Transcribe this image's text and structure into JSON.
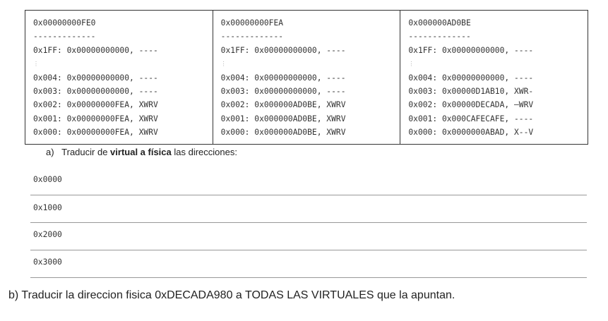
{
  "tables": [
    {
      "header": "0x00000000FE0",
      "sep": "-------------",
      "rows": [
        "0x1FF: 0x00000000000, ----",
        "⋮",
        "0x004: 0x00000000000, ----",
        "0x003: 0x00000000000, ----",
        "0x002: 0x00000000FEA, XWRV",
        "0x001: 0x00000000FEA, XWRV",
        "0x000: 0x00000000FEA, XWRV"
      ]
    },
    {
      "header": "0x00000000FEA",
      "sep": "-------------",
      "rows": [
        "0x1FF: 0x00000000000, ----",
        "⋮",
        "0x004: 0x00000000000, ----",
        "0x003: 0x00000000000, ----",
        "0x002: 0x000000AD0BE, XWRV",
        "0x001: 0x000000AD0BE, XWRV",
        "0x000: 0x000000AD0BE, XWRV"
      ]
    },
    {
      "header": "0x000000AD0BE",
      "sep": "-------------",
      "rows": [
        "0x1FF: 0x00000000000, ----",
        "⋮",
        "0x004: 0x00000000000, ----",
        "0x003: 0x00000D1AB10, XWR-",
        "0x002: 0x00000DECADA, –WRV",
        "0x001: 0x000CAFECAFE, ----",
        "0x000: 0x0000000ABAD, X--V"
      ]
    }
  ],
  "question_a": {
    "prefix": "a)   Traducir de ",
    "bold": "virtual a física",
    "suffix": " las direcciones:"
  },
  "addresses": [
    "0x0000",
    "0x1000",
    "0x2000",
    "0x3000"
  ],
  "question_b": "b) Traducir la direccion fisica 0xDECADA980 a TODAS LAS VIRTUALES que la apuntan."
}
